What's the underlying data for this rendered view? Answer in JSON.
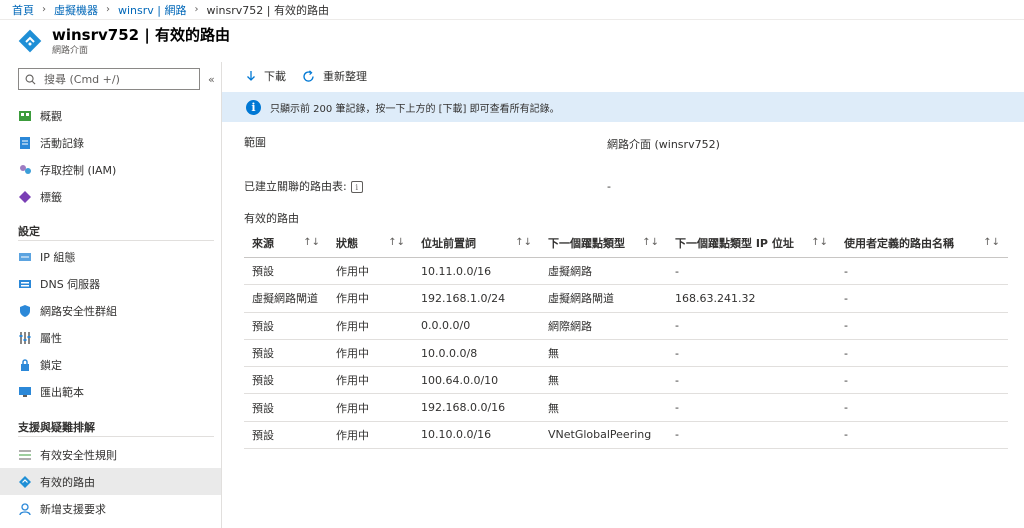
{
  "breadcrumb": {
    "items": [
      "首頁",
      "虛擬機器",
      "winsrv | 網路"
    ],
    "current": "winsrv752 | 有效的路由"
  },
  "header": {
    "title": "winsrv752 | 有效的路由",
    "subtitle": "網路介面"
  },
  "sidebar": {
    "search_placeholder": "搜尋 (Cmd +/)",
    "collapse": "«",
    "items_top": [
      {
        "label": "概觀",
        "icon": "overview-icon"
      },
      {
        "label": "活動記錄",
        "icon": "activity-log-icon"
      },
      {
        "label": "存取控制 (IAM)",
        "icon": "iam-icon"
      },
      {
        "label": "標籤",
        "icon": "tag-icon"
      }
    ],
    "settings_heading": "設定",
    "settings_items": [
      {
        "label": "IP 組態",
        "icon": "ip-config-icon"
      },
      {
        "label": "DNS 伺服器",
        "icon": "dns-icon"
      },
      {
        "label": "網路安全性群組",
        "icon": "nsg-icon"
      },
      {
        "label": "屬性",
        "icon": "properties-icon"
      },
      {
        "label": "鎖定",
        "icon": "lock-icon"
      },
      {
        "label": "匯出範本",
        "icon": "export-template-icon"
      }
    ],
    "support_heading": "支援與疑難排解",
    "support_items": [
      {
        "label": "有效安全性規則",
        "icon": "security-rules-icon"
      },
      {
        "label": "有效的路由",
        "icon": "routes-icon",
        "active": true
      },
      {
        "label": "新增支援要求",
        "icon": "support-icon"
      }
    ]
  },
  "toolbar": {
    "download": "下載",
    "refresh": "重新整理"
  },
  "info": {
    "text": "只顯示前 200 筆記錄，按一下上方的 [下載] 即可查看所有記錄。"
  },
  "scope": {
    "label": "範圍",
    "value": "網路介面 (winsrv752)"
  },
  "route_table": {
    "label": "已建立關聯的路由表:",
    "value": "-"
  },
  "routes": {
    "title": "有效的路由",
    "columns": [
      "來源",
      "狀態",
      "位址前置詞",
      "下一個躍點類型",
      "下一個躍點類型 IP 位址",
      "使用者定義的路由名稱"
    ],
    "rows": [
      [
        "預設",
        "作用中",
        "10.11.0.0/16",
        "虛擬網路",
        "-",
        "-"
      ],
      [
        "虛擬網路閘道",
        "作用中",
        "192.168.1.0/24",
        "虛擬網路閘道",
        "168.63.241.32",
        "-"
      ],
      [
        "預設",
        "作用中",
        "0.0.0.0/0",
        "網際網路",
        "-",
        "-"
      ],
      [
        "預設",
        "作用中",
        "10.0.0.0/8",
        "無",
        "-",
        "-"
      ],
      [
        "預設",
        "作用中",
        "100.64.0.0/10",
        "無",
        "-",
        "-"
      ],
      [
        "預設",
        "作用中",
        "192.168.0.0/16",
        "無",
        "-",
        "-"
      ],
      [
        "預設",
        "作用中",
        "10.10.0.0/16",
        "VNetGlobalPeering",
        "-",
        "-"
      ]
    ]
  },
  "colors": {
    "accent": "#0078d4",
    "link": "#0067b8",
    "info_bg": "#deecf9",
    "active_nav": "#eaeaea"
  }
}
